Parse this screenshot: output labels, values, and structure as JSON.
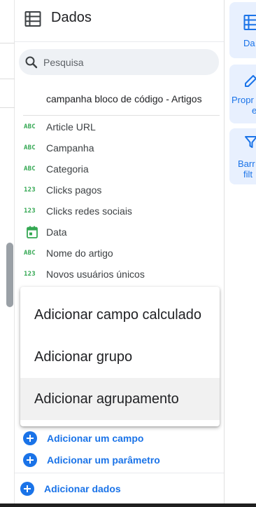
{
  "panel": {
    "title": "Dados",
    "search_placeholder": "Pesquisa",
    "source_name": "campanha bloco de código - Artigos"
  },
  "fields": [
    {
      "type": "ABC",
      "label": "Article URL"
    },
    {
      "type": "ABC",
      "label": "Campanha"
    },
    {
      "type": "ABC",
      "label": "Categoria"
    },
    {
      "type": "123",
      "label": "Clicks pagos"
    },
    {
      "type": "123",
      "label": "Clicks redes sociais"
    },
    {
      "type": "calendar",
      "label": "Data"
    },
    {
      "type": "ABC",
      "label": "Nome do artigo"
    },
    {
      "type": "123",
      "label": "Novos usuários únicos"
    }
  ],
  "menu": {
    "items": [
      "Adicionar campo calculado",
      "Adicionar grupo",
      "Adicionar agrupamento"
    ],
    "hovered_index": 2
  },
  "actions": {
    "add_field": "Adicionar um campo",
    "add_parameter": "Adicionar um parâmetro",
    "add_data": "Adicionar dados"
  },
  "rail": {
    "buttons": [
      {
        "icon": "table-icon",
        "label_line1": "Da",
        "label_line2": ""
      },
      {
        "icon": "pencil-icon",
        "label_line1": "Propr",
        "label_line2": "e"
      },
      {
        "icon": "filter-icon",
        "label_line1": "Barr",
        "label_line2": "filt"
      }
    ]
  },
  "colors": {
    "accent": "#1a73e8",
    "type_green": "#34a853",
    "rail_bg": "#e8f0fe",
    "search_bg": "#eef1f5"
  }
}
